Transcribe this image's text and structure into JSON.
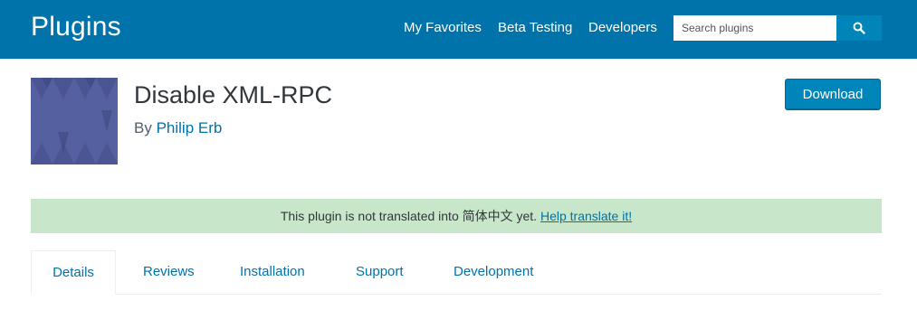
{
  "header": {
    "title": "Plugins",
    "nav": [
      "My Favorites",
      "Beta Testing",
      "Developers"
    ],
    "search_placeholder": "Search plugins",
    "search_icon": "search-icon",
    "bg_color": "#0073aa"
  },
  "plugin": {
    "banner_icon": "plugin-banner",
    "name": "Disable XML-RPC",
    "by_label": "By",
    "author": "Philip Erb",
    "download_label": "Download"
  },
  "notice": {
    "text": "This plugin is not translated into 简体中文 yet.",
    "link": "Help translate it!",
    "bg_color": "#c8e6c9"
  },
  "tabs": [
    "Details",
    "Reviews",
    "Installation",
    "Support",
    "Development"
  ],
  "active_tab": "Details"
}
